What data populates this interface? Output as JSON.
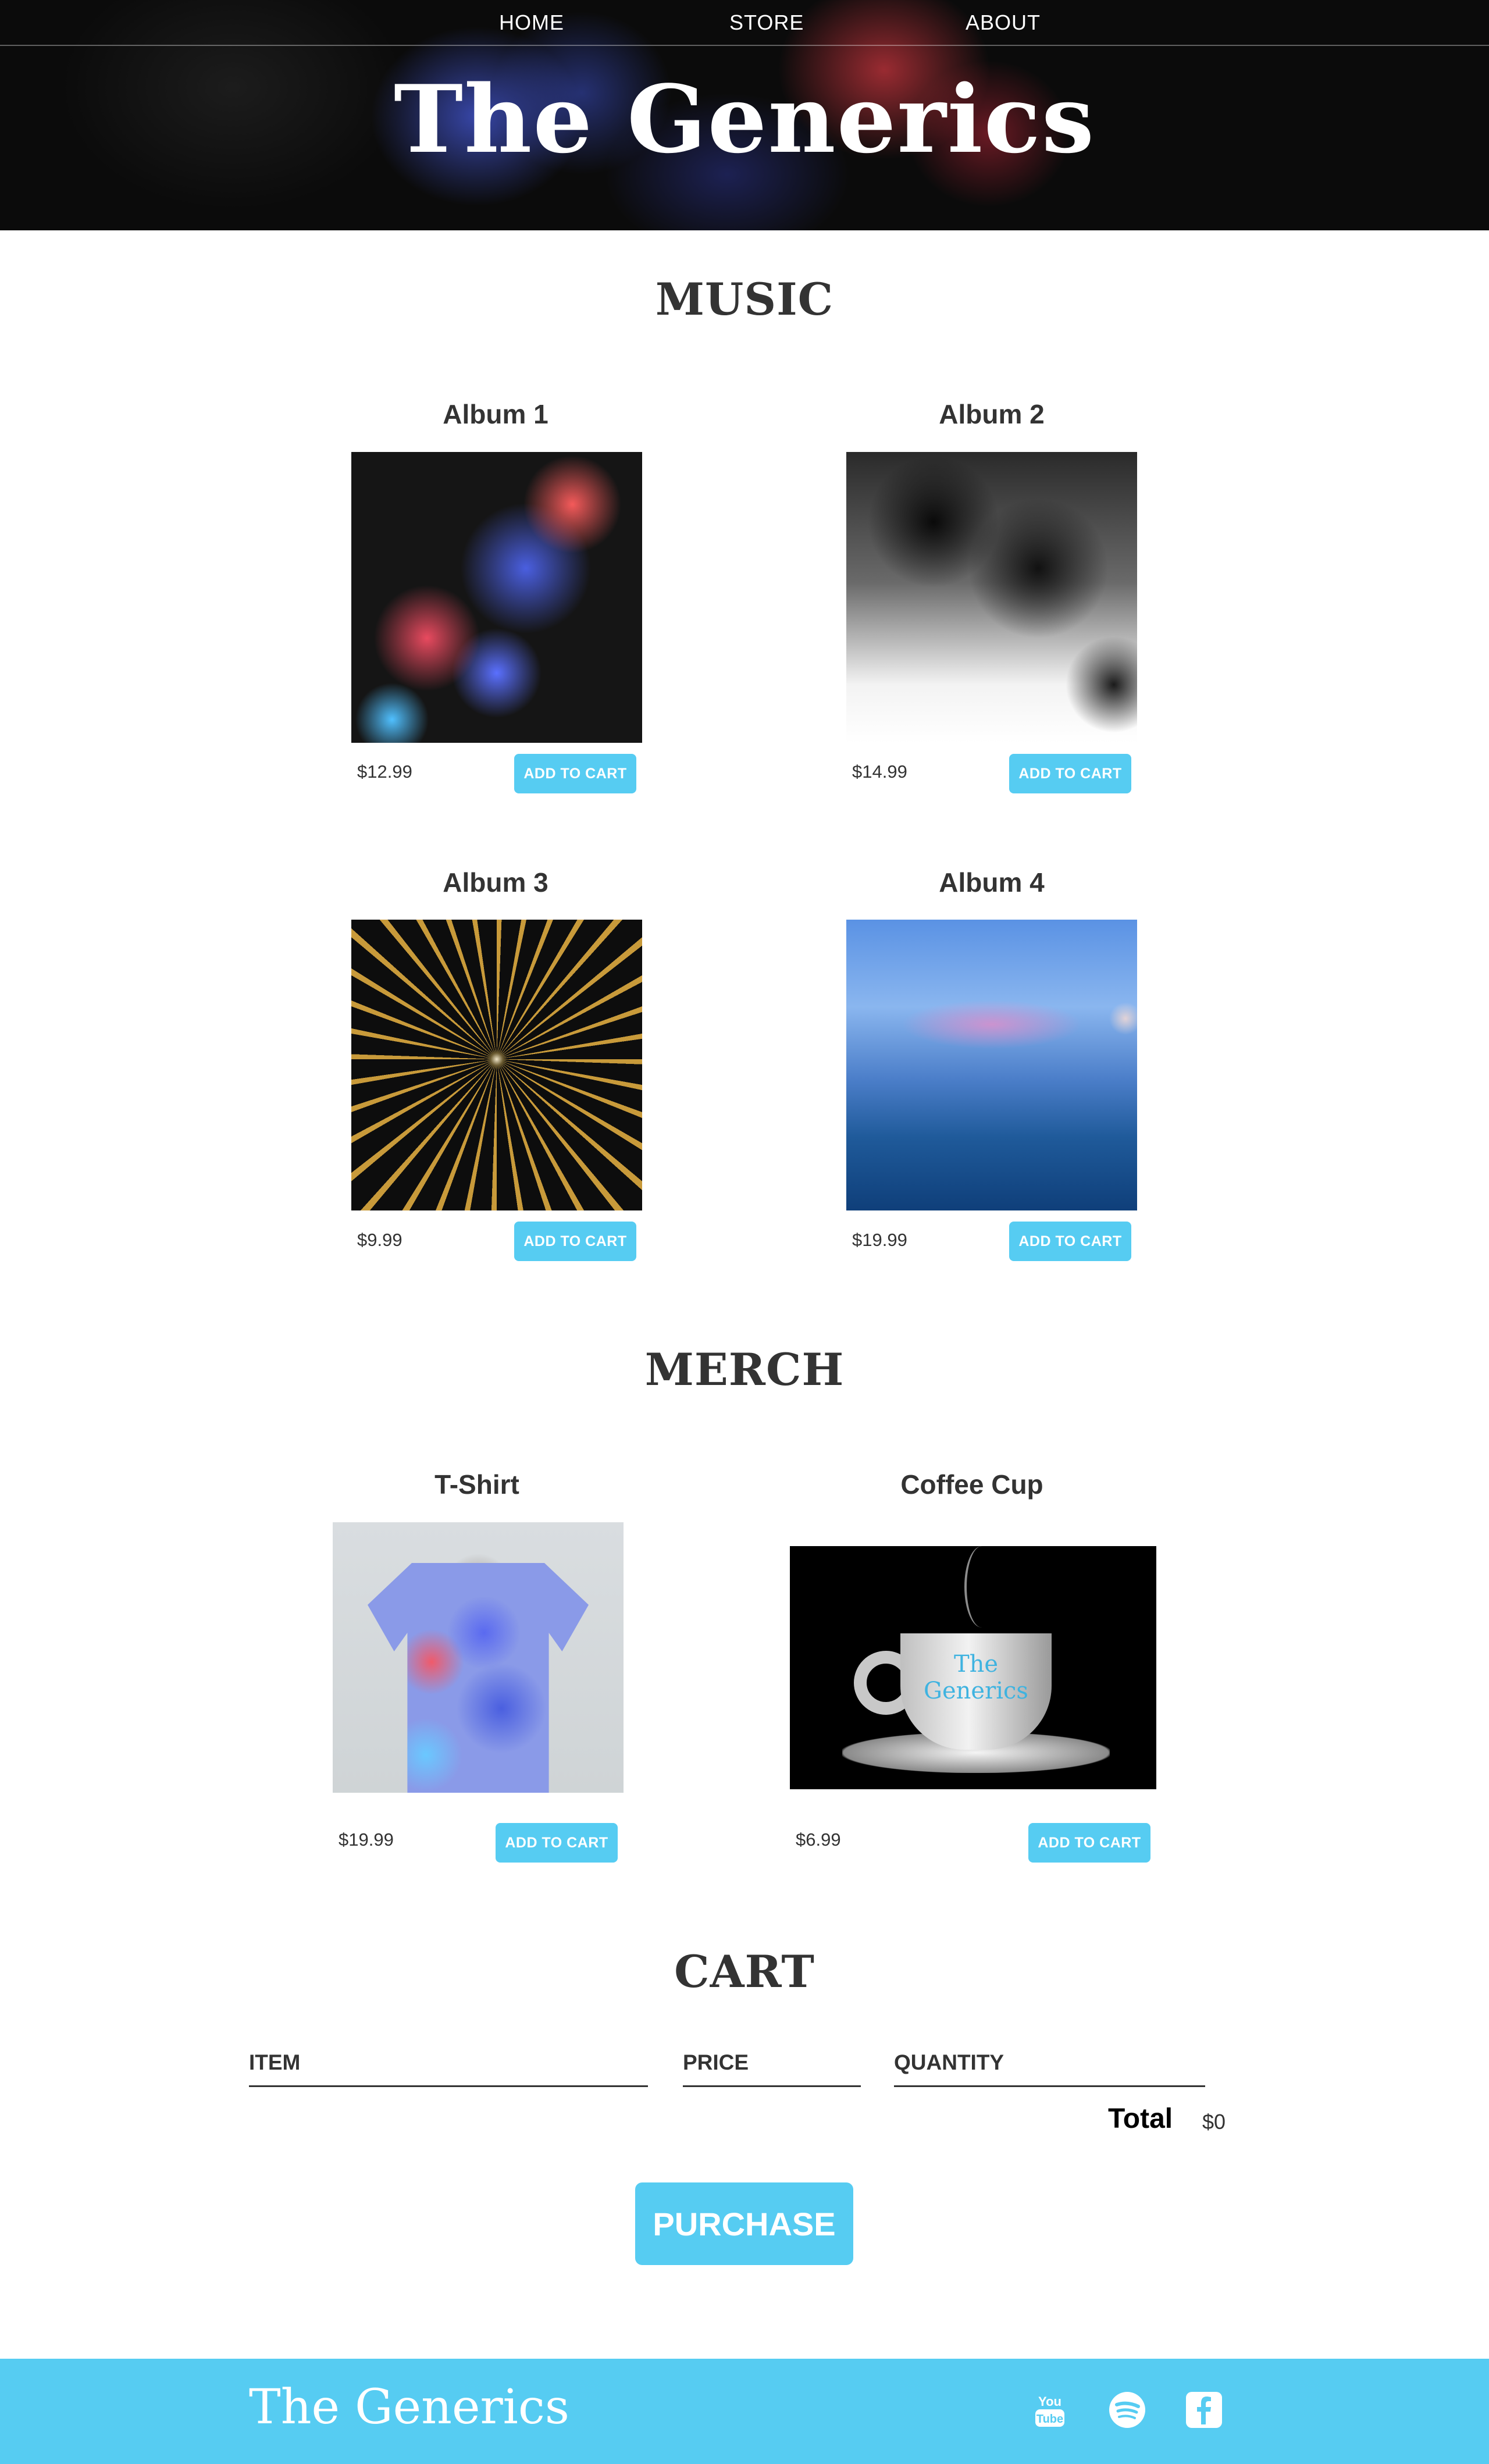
{
  "nav": {
    "home": "HOME",
    "store": "STORE",
    "about": "ABOUT"
  },
  "header": {
    "band_name": "The Generics"
  },
  "music": {
    "title": "MUSIC",
    "albums": [
      {
        "title": "Album 1",
        "price": "$12.99",
        "button": "ADD TO CART"
      },
      {
        "title": "Album 2",
        "price": "$14.99",
        "button": "ADD TO CART"
      },
      {
        "title": "Album 3",
        "price": "$9.99",
        "button": "ADD TO CART"
      },
      {
        "title": "Album 4",
        "price": "$19.99",
        "button": "ADD TO CART"
      }
    ]
  },
  "merch": {
    "title": "MERCH",
    "items": [
      {
        "title": "T-Shirt",
        "price": "$19.99",
        "button": "ADD TO CART"
      },
      {
        "title": "Coffee Cup",
        "price": "$6.99",
        "button": "ADD TO CART",
        "image_text": "The Generics"
      }
    ]
  },
  "cart": {
    "title": "CART",
    "columns": [
      "ITEM",
      "PRICE",
      "QUANTITY"
    ],
    "total_label": "Total",
    "total_value": "$0",
    "purchase": "PURCHASE"
  },
  "footer": {
    "band_name": "The Generics",
    "social_icons": [
      "youtube-icon",
      "spotify-icon",
      "facebook-icon"
    ]
  },
  "colors": {
    "accent": "#56ccf2",
    "text": "#333333",
    "header_bg": "#0b0b0b"
  }
}
